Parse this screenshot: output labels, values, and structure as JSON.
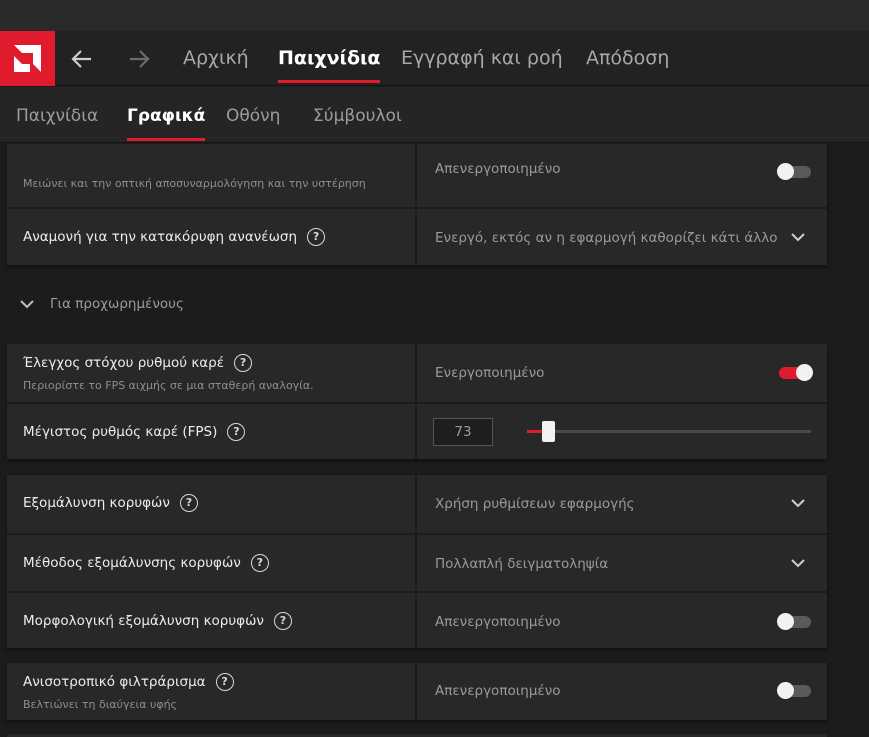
{
  "nav": {
    "tabs": [
      "Αρχική",
      "Παιχνίδια",
      "Εγγραφή και ροή",
      "Απόδοση"
    ],
    "active": 1
  },
  "subnav": {
    "tabs": [
      "Παιχνίδια",
      "Γραφικά",
      "Οθόνη",
      "Σύμβουλοι"
    ],
    "active": 1
  },
  "settings": {
    "top_partial": {
      "subtitle": "Μειώνει και την οπτική αποσυναρμολόγηση και την υστέρηση",
      "value": "Απενεργοποιημένο",
      "enabled": false
    },
    "vsync": {
      "label": "Αναμονή για την κατακόρυφη ανανέωση",
      "value": "Ενεργό, εκτός αν η εφαρμογή καθορίζει κάτι άλλο"
    },
    "advanced_header": "Για προχωρημένους",
    "frtc": {
      "label": "Έλεγχος στόχου ρυθμού καρέ",
      "subtitle": "Περιορίστε το FPS αιχμής σε μια σταθερή αναλογία.",
      "value": "Ενεργοποιημένο",
      "enabled": true
    },
    "max_fps": {
      "label": "Μέγιστος ρυθμός καρέ (FPS)",
      "value": "73",
      "slider_fraction": 0.075
    },
    "aa": {
      "label": "Εξομάλυνση κορυφών",
      "value": "Χρήση ρυθμίσεων εφαρμογής"
    },
    "aa_method": {
      "label": "Μέθοδος εξομάλυνσης κορυφών",
      "value": "Πολλαπλή δειγματοληψία"
    },
    "mlaa": {
      "label": "Μορφολογική εξομάλυνση κορυφών",
      "value": "Απενεργοποιημένο",
      "enabled": false
    },
    "aniso": {
      "label": "Ανισοτροπικό φιλτράρισμα",
      "subtitle": "Βελτιώνει τη διαύγεια υφής",
      "value": "Απενεργοποιημένο",
      "enabled": false
    }
  },
  "help_glyph": "?",
  "colors": {
    "accent": "#e01b2e",
    "background": "#1c1c1c",
    "card": "#282828"
  }
}
